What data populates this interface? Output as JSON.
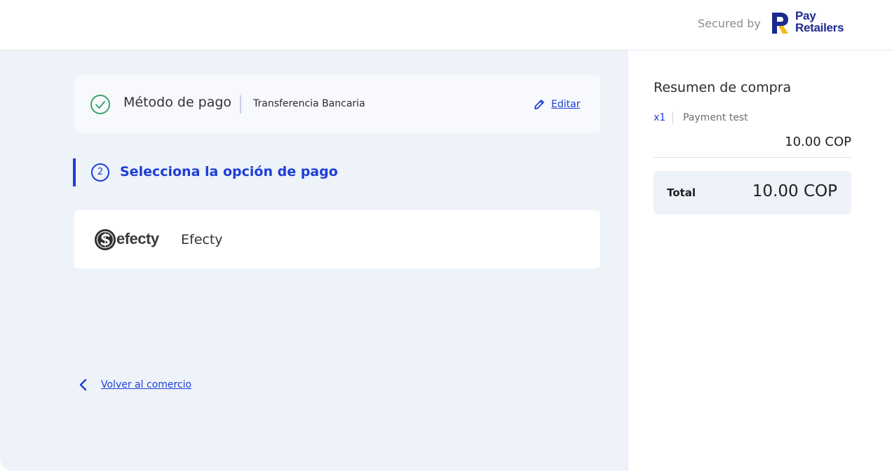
{
  "header": {
    "secured_by": "Secured by",
    "logo": {
      "line1": "Pay",
      "line2": "Retailers",
      "icon": "payretailers-logo-icon"
    }
  },
  "payment_method": {
    "title": "Método de pago",
    "value": "Transferencia Bancaria",
    "edit_label": "Editar",
    "status_icon": "check-circle-icon",
    "edit_icon": "pencil-icon"
  },
  "step": {
    "number": "2",
    "title": "Selecciona la opción de pago"
  },
  "options": [
    {
      "name": "Efecty",
      "logo_text": "efecty",
      "logo_icon": "efecty-logo"
    }
  ],
  "back_link": {
    "label": "Volver al comercio",
    "icon": "chevron-left-icon"
  },
  "summary": {
    "title": "Resumen de compra",
    "items": [
      {
        "qty": "x1",
        "name": "Payment test",
        "price": "10.00 COP"
      }
    ],
    "total_label": "Total",
    "total_value": "10.00 COP"
  },
  "colors": {
    "accent": "#1c3ed6",
    "brand_navy": "#1c2a8f",
    "brand_yellow": "#f5b919",
    "success": "#3aa66b",
    "panel_bg": "#eef2f9"
  }
}
